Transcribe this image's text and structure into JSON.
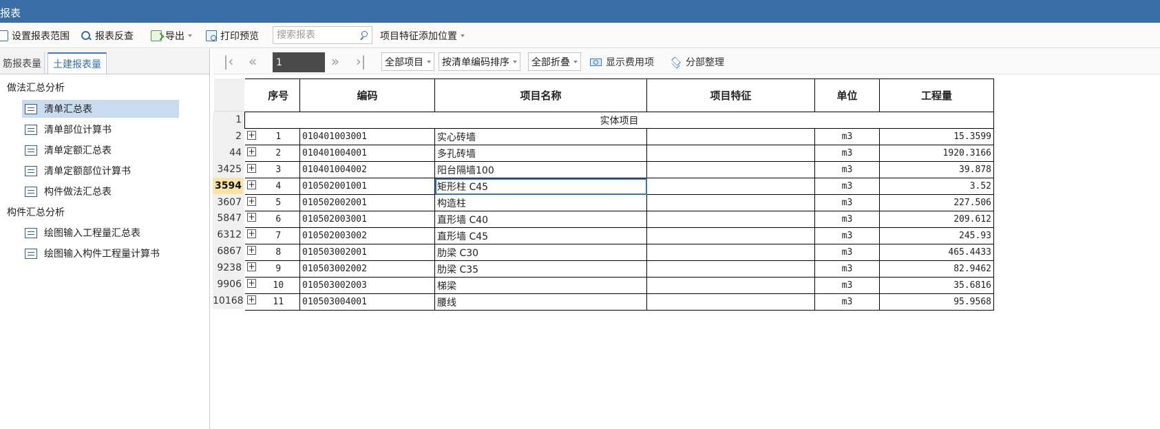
{
  "window": {
    "title": "报表"
  },
  "toolbar": {
    "set_range": "设置报表范围",
    "report_check": "报表反查",
    "export": "导出",
    "print_preview": "打印预览",
    "search_placeholder": "搜索报表",
    "feature_position": "项目特征添加位置"
  },
  "tabs": {
    "rebar": "筋报表量",
    "civil": "土建报表量"
  },
  "sidebar": {
    "group1": "做法汇总分析",
    "group1_items": [
      "清单汇总表",
      "清单部位计算书",
      "清单定额汇总表",
      "清单定额部位计算书",
      "构件做法汇总表"
    ],
    "group2": "构件汇总分析",
    "group2_items": [
      "绘图输入工程量汇总表",
      "绘图输入构件工程量计算书"
    ],
    "selected": "清单汇总表"
  },
  "nav": {
    "first": "|‹",
    "prev": "«",
    "page": "1",
    "next": "»",
    "last": "›|",
    "all_items": "全部项目",
    "sort": "按清单编码排序",
    "collapse": "全部折叠",
    "show_fee": "显示费用项",
    "section_arrange": "分部整理"
  },
  "table": {
    "headers": [
      "序号",
      "编码",
      "项目名称",
      "项目特征",
      "单位",
      "工程量"
    ],
    "section_title": "实体项目",
    "section_row_number": "1",
    "current_row_number": "3594",
    "rows": [
      {
        "rownum": "2",
        "no": "1",
        "code": "010401003001",
        "name": "实心砖墙",
        "feature": "",
        "unit": "m3",
        "qty": "15.3599"
      },
      {
        "rownum": "44",
        "no": "2",
        "code": "010401004001",
        "name": "多孔砖墙",
        "feature": "",
        "unit": "m3",
        "qty": "1920.3166"
      },
      {
        "rownum": "3425",
        "no": "3",
        "code": "010401004002",
        "name": "阳台隔墙100",
        "feature": "",
        "unit": "m3",
        "qty": "39.878"
      },
      {
        "rownum": "3594",
        "no": "4",
        "code": "010502001001",
        "name": "矩形柱 C45",
        "feature": "",
        "unit": "m3",
        "qty": "3.52"
      },
      {
        "rownum": "3607",
        "no": "5",
        "code": "010502002001",
        "name": "构造柱",
        "feature": "",
        "unit": "m3",
        "qty": "227.506"
      },
      {
        "rownum": "5847",
        "no": "6",
        "code": "010502003001",
        "name": "直形墙 C40",
        "feature": "",
        "unit": "m3",
        "qty": "209.612"
      },
      {
        "rownum": "6312",
        "no": "7",
        "code": "010502003002",
        "name": "直形墙 C45",
        "feature": "",
        "unit": "m3",
        "qty": "245.93"
      },
      {
        "rownum": "6867",
        "no": "8",
        "code": "010503002001",
        "name": "肋梁 C30",
        "feature": "",
        "unit": "m3",
        "qty": "465.4433"
      },
      {
        "rownum": "9238",
        "no": "9",
        "code": "010503002002",
        "name": "肋梁 C35",
        "feature": "",
        "unit": "m3",
        "qty": "82.9462"
      },
      {
        "rownum": "9906",
        "no": "10",
        "code": "010503002003",
        "name": "梯梁",
        "feature": "",
        "unit": "m3",
        "qty": "35.6816"
      },
      {
        "rownum": "10168",
        "no": "11",
        "code": "010503004001",
        "name": "腰线",
        "feature": "",
        "unit": "m3",
        "qty": "95.9568"
      }
    ]
  },
  "colors": {
    "titlebar": "#3a6ea8",
    "selection": "#c9dbef",
    "current_row": "#fbe3a4",
    "focus": "#2f74c6"
  },
  "icons": [
    "range-icon",
    "report-check-icon",
    "export-icon",
    "print-preview-icon",
    "search-icon",
    "document-icon",
    "money-icon",
    "layers-icon",
    "expand-icon"
  ]
}
